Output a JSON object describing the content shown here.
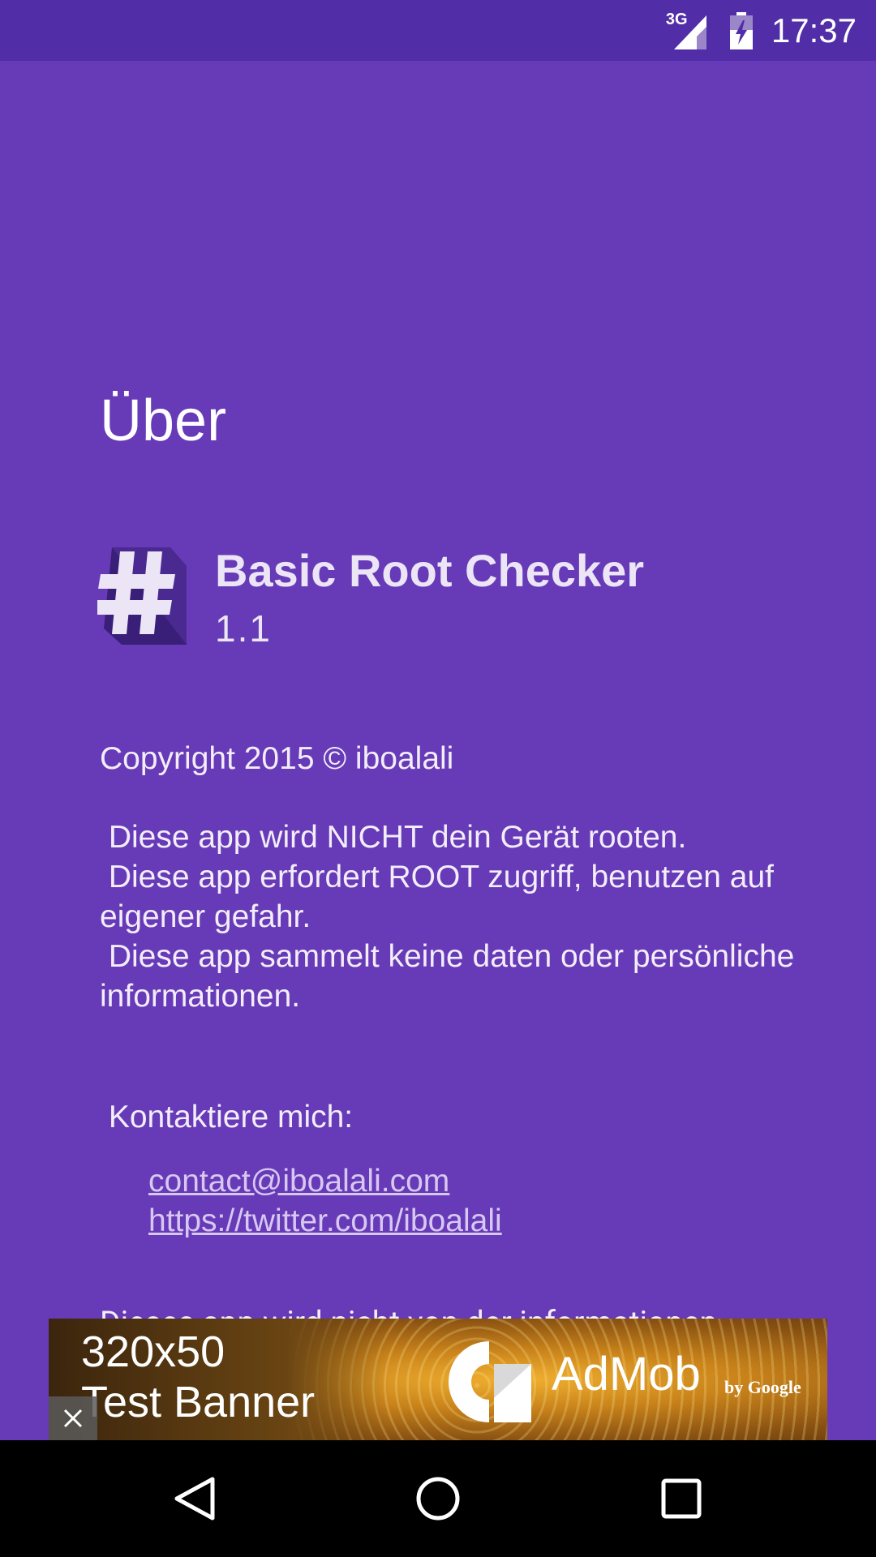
{
  "status_bar": {
    "network_label": "3G",
    "time": "17:37",
    "network_icon": "signal-3g-icon",
    "battery_icon": "battery-charging-icon"
  },
  "about": {
    "title": "Über",
    "app_icon": "hash-app-icon",
    "app_name": "Basic Root Checker",
    "version": "1.1",
    "copyright": "Copyright 2015 © iboalali",
    "disclaimer": " Diese app wird NICHT dein Gerät rooten.\n Diese app erfordert ROOT zugriff, benutzen auf eigener gefahr.\n Diese app sammelt keine daten oder persönliche informationen.",
    "contact_heading": " Kontaktiere mich:",
    "links": [
      {
        "label": "contact@iboalali.com"
      },
      {
        "label": "https://twitter.com/iboalali"
      }
    ],
    "cut_text": "Dieses app wird nicht von der informationen"
  },
  "ad_banner": {
    "size_label": "320x50",
    "test_label": "Test Banner",
    "brand": "AdMob",
    "brand_sub": "by Google",
    "close_icon": "close-icon",
    "colors": {
      "gold": "#c8821a",
      "dark": "#3b250d"
    }
  },
  "nav_bar": {
    "back_icon": "back-triangle-icon",
    "home_icon": "home-circle-icon",
    "recents_icon": "recents-square-icon"
  },
  "colors": {
    "background": "#673ab7",
    "status_bar": "#512da8",
    "link": "#d7c8f3",
    "nav_bar": "#000000"
  }
}
